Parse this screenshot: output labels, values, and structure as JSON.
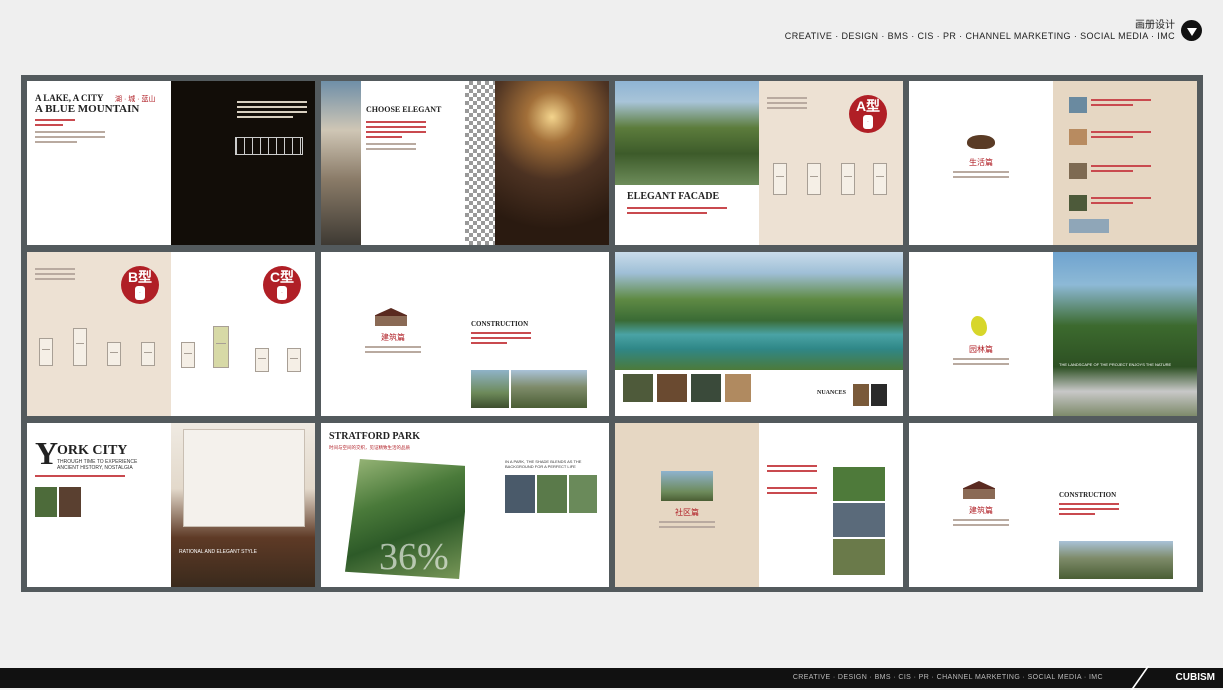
{
  "header": {
    "title": "画册设计",
    "subtitle": "CREATIVE · DESIGN · BMS · CIS · PR · CHANNEL MARKETING · SOCIAL MEDIA · IMC",
    "nav_icon": "chevron-down-icon"
  },
  "spreads": {
    "s1": {
      "line1": "A LAKE, A CITY",
      "line1_red": "湖 · 城 · 蓝山",
      "line2": "A BLUE MOUNTAIN"
    },
    "s2": {
      "title": "CHOOSE ELEGANT"
    },
    "s3": {
      "title": "ELEGANT FACADE",
      "badge": "A型"
    },
    "s4": {
      "caption": "生活篇"
    },
    "s5": {
      "badge_b": "B型",
      "badge_c": "C型"
    },
    "s6": {
      "caption": "建筑篇",
      "title": "CONSTRUCTION"
    },
    "s7": {
      "caption": "NUANCES"
    },
    "s8": {
      "caption": "园林篇",
      "quote": "THE LANDSCAPE OF THE PROJECT ENJOYS THE NATURE"
    },
    "s9": {
      "title_big": "Y",
      "title_rest": "ORK CITY",
      "sub1": "THROUGH TIME TO EXPERIENCE",
      "sub2": "ANCIENT HISTORY, NOSTALGIA",
      "caption": "RATIONAL AND ELEGANT STYLE"
    },
    "s10": {
      "title": "STRATFORD PARK",
      "red": "时间与空间的交织，见证精致生活的品质",
      "percent": "36%",
      "right_text": "IN A PARK, THE SHADE BLENDS AS THE BACKGROUND FOR A PERFECT LIFE"
    },
    "s11": {
      "caption": "社区篇"
    },
    "s12": {
      "caption": "建筑篇",
      "title": "CONSTRUCTION"
    }
  },
  "footer": {
    "text": "CREATIVE · DESIGN · BMS · CIS · PR · CHANNEL MARKETING · SOCIAL MEDIA · IMC",
    "logo": "CUBISM"
  }
}
